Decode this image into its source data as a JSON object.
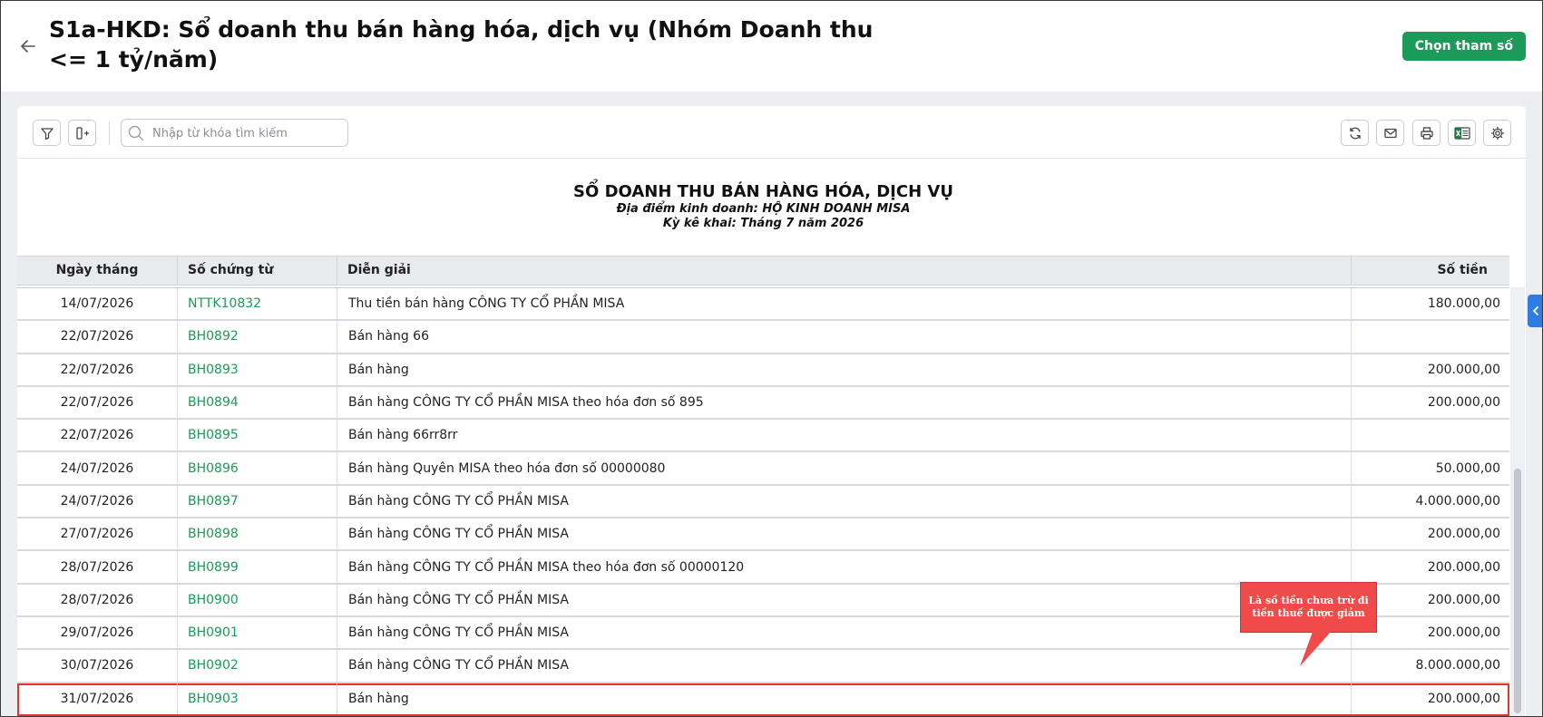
{
  "header": {
    "title": "S1a-HKD: Sổ doanh thu bán hàng hóa, dịch vụ (Nhóm Doanh thu <= 1 tỷ/năm)",
    "choose_button": "Chọn tham số"
  },
  "toolbar": {
    "search_placeholder": "Nhập từ khóa tìm kiếm",
    "icons_left": [
      "filter-icon",
      "column-settings-icon"
    ],
    "icons_right": [
      "refresh-icon",
      "mail-icon",
      "print-icon",
      "excel-icon",
      "gear-icon"
    ]
  },
  "report": {
    "title": "SỔ DOANH THU BÁN HÀNG HÓA, DỊCH VỤ",
    "location": "Địa điểm kinh doanh: HỘ KINH DOANH MISA",
    "period": "Kỳ kê khai: Tháng 7 năm 2026"
  },
  "table": {
    "columns": [
      "Ngày tháng",
      "Số chứng từ",
      "Diễn giải",
      "Số tiền"
    ],
    "rows": [
      {
        "date": "14/07/2026",
        "doc": "NTTK10832",
        "desc": "Thu tiền bán hàng CÔNG TY CỔ PHẦN MISA",
        "amount": "180.000,00"
      },
      {
        "date": "22/07/2026",
        "doc": "BH0892",
        "desc": "Bán hàng 66",
        "amount": ""
      },
      {
        "date": "22/07/2026",
        "doc": "BH0893",
        "desc": "Bán hàng",
        "amount": "200.000,00"
      },
      {
        "date": "22/07/2026",
        "doc": "BH0894",
        "desc": "Bán hàng CÔNG TY CỔ PHẦN MISA theo hóa đơn số 895",
        "amount": "200.000,00"
      },
      {
        "date": "22/07/2026",
        "doc": "BH0895",
        "desc": "Bán hàng 66rr8rr",
        "amount": ""
      },
      {
        "date": "24/07/2026",
        "doc": "BH0896",
        "desc": "Bán hàng Quyên MISA theo hóa đơn số 00000080",
        "amount": "50.000,00"
      },
      {
        "date": "24/07/2026",
        "doc": "BH0897",
        "desc": "Bán hàng CÔNG TY CỔ PHẦN MISA",
        "amount": "4.000.000,00"
      },
      {
        "date": "27/07/2026",
        "doc": "BH0898",
        "desc": "Bán hàng CÔNG TY CỔ PHẦN MISA",
        "amount": "200.000,00"
      },
      {
        "date": "28/07/2026",
        "doc": "BH0899",
        "desc": "Bán hàng CÔNG TY CỔ PHẦN MISA theo hóa đơn số 00000120",
        "amount": "200.000,00"
      },
      {
        "date": "28/07/2026",
        "doc": "BH0900",
        "desc": "Bán hàng CÔNG TY CỔ PHẦN MISA",
        "amount": "200.000,00"
      },
      {
        "date": "29/07/2026",
        "doc": "BH0901",
        "desc": "Bán hàng CÔNG TY CỔ PHẦN MISA",
        "amount": "200.000,00"
      },
      {
        "date": "30/07/2026",
        "doc": "BH0902",
        "desc": "Bán hàng CÔNG TY CỔ PHẦN MISA",
        "amount": "8.000.000,00"
      },
      {
        "date": "31/07/2026",
        "doc": "BH0903",
        "desc": "Bán hàng",
        "amount": "200.000,00"
      }
    ]
  },
  "callout": {
    "text": "Là số tiền chưa trừ đi tiền thuế được giảm"
  },
  "colors": {
    "brand_green": "#1b9a59",
    "link_green": "#1e9a57",
    "highlight_red": "#e0352f",
    "callout_red": "#f04a4a",
    "side_tab_blue": "#2f7de1"
  }
}
